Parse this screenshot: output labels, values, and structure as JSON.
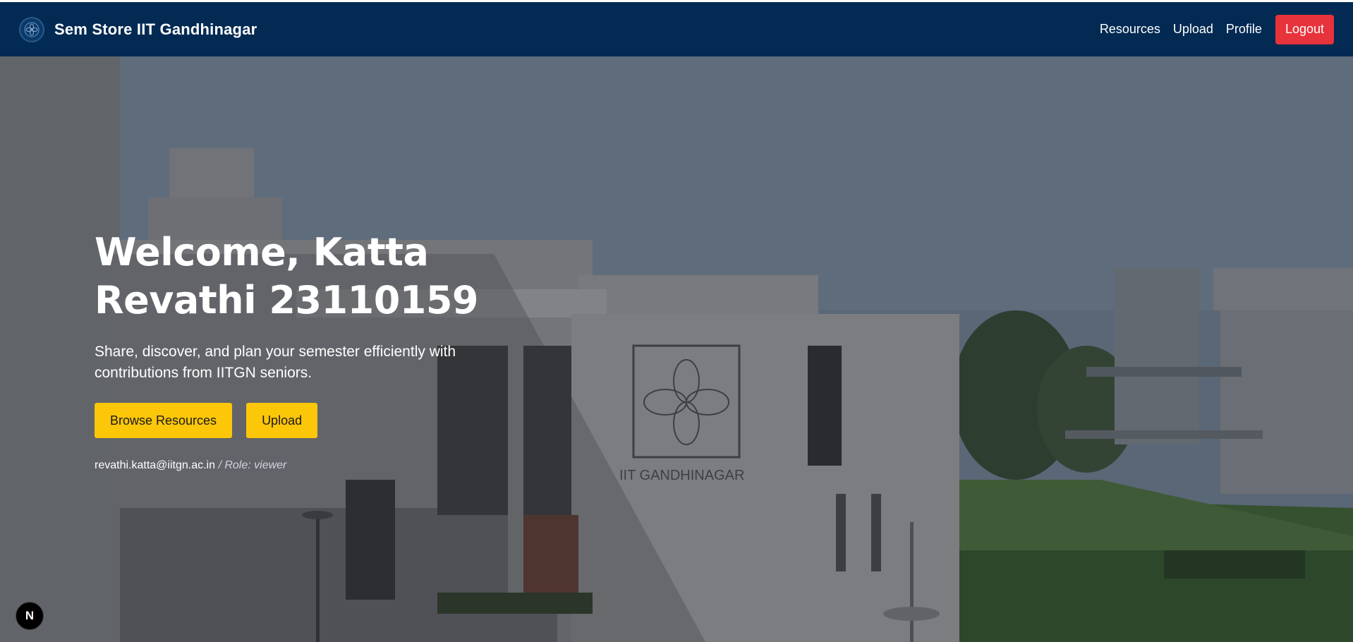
{
  "header": {
    "brand_title": "Sem Store IIT Gandhinagar",
    "nav": [
      "Resources",
      "Upload",
      "Profile"
    ],
    "logout_label": "Logout"
  },
  "hero": {
    "title": "Welcome, Katta Revathi 23110159",
    "subtitle": "Share, discover, and plan your semester efficiently with contributions from IITGN seniors.",
    "buttons": [
      "Browse Resources",
      "Upload"
    ],
    "email": "revathi.katta@iitgn.ac.in",
    "role": "/ Role: viewer",
    "sign_text": "IIT GANDHINAGAR"
  },
  "dev_badge": "N",
  "colors": {
    "navbar": "#022a52",
    "logout": "#e7333b",
    "accent_button": "#fcc609"
  },
  "icons": {
    "logo": "iitgn-logo-icon",
    "badge": "nextjs-badge-icon"
  }
}
